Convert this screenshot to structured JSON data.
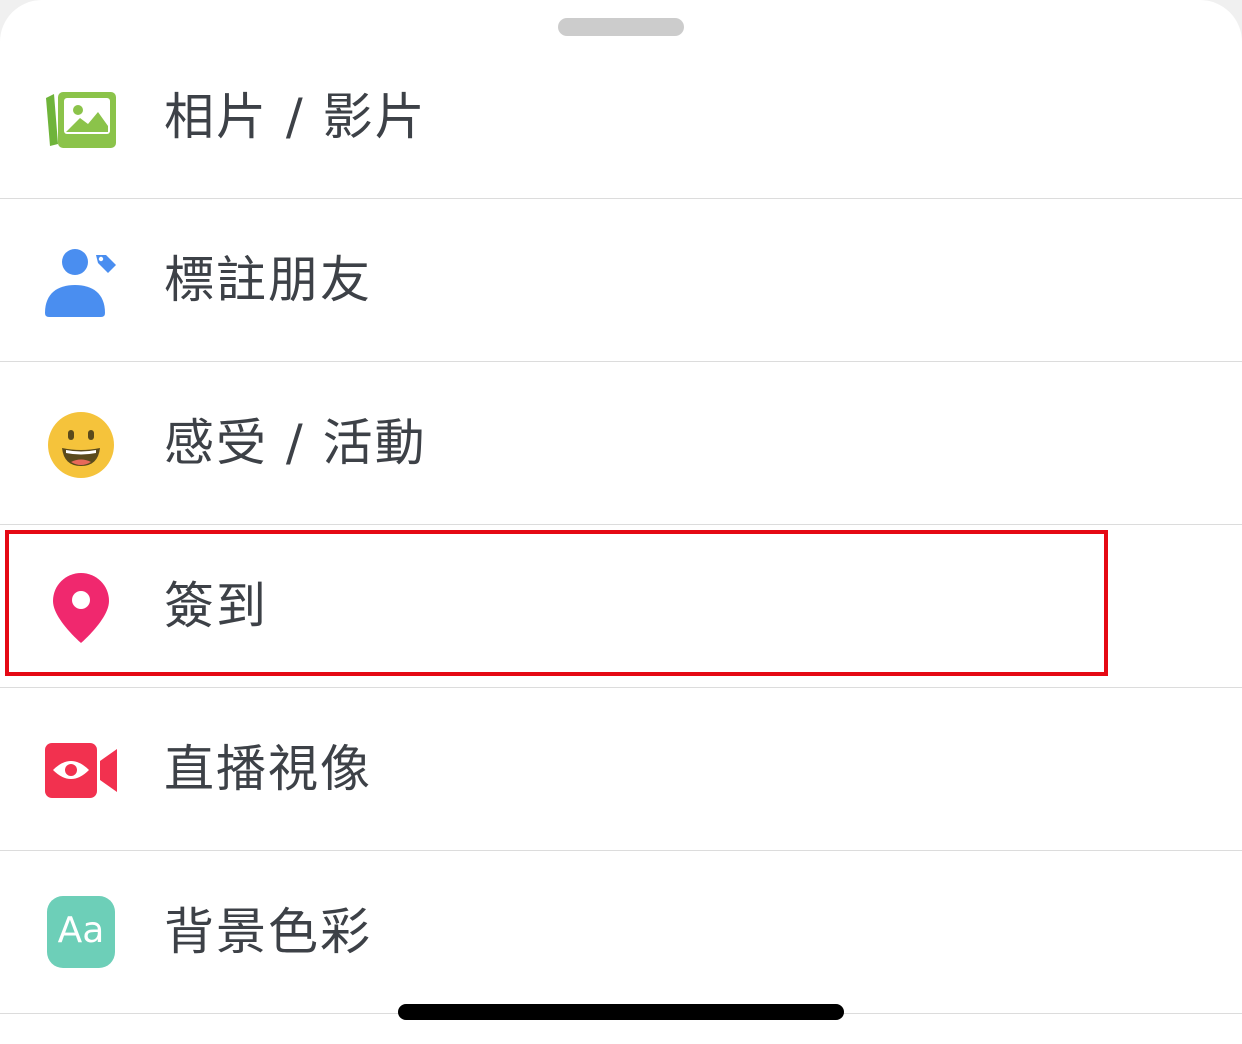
{
  "menu": {
    "items": [
      {
        "label": "相片 / 影片",
        "icon": "photo-video-icon",
        "color": "#8bc34a"
      },
      {
        "label": "標註朋友",
        "icon": "tag-friends-icon",
        "color": "#4a8ef0"
      },
      {
        "label": "感受 / 活動",
        "icon": "feeling-emoji-icon",
        "color": "#f5c33b"
      },
      {
        "label": "簽到",
        "icon": "location-pin-icon",
        "color": "#f0286e"
      },
      {
        "label": "直播視像",
        "icon": "live-video-icon",
        "color": "#f2314f"
      },
      {
        "label": "背景色彩",
        "icon": "background-color-icon",
        "color": "#6dcfb8",
        "icon_text": "Aa"
      }
    ],
    "highlighted_index": 3,
    "highlight_color": "#e50914"
  }
}
